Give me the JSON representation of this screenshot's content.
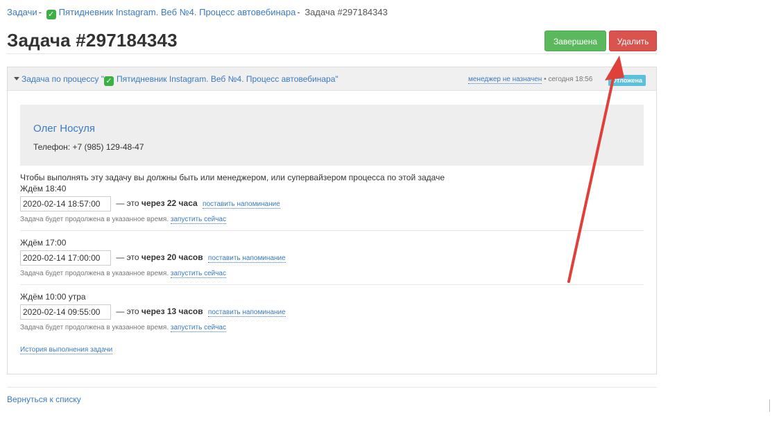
{
  "breadcrumb": {
    "items": [
      "Задачи",
      "Пятидневник Instagram. Веб №4. Процесс автовебинара"
    ],
    "separator": "-",
    "current": "Задача #297184343"
  },
  "page": {
    "title": "Задача #297184343",
    "done_button": "Завершена",
    "delete_button": "Удалить"
  },
  "panel": {
    "toggle_prefix": "Задача по процессу \"",
    "process_name": "Пятидневник Instagram. Веб №4. Процесс автовебинара",
    "toggle_suffix": "\"",
    "manager": "менеджер не назначен",
    "meta_sep": " • ",
    "time": "сегодня 18:56",
    "status": "Отложена"
  },
  "contact": {
    "name": "Олег Носуля",
    "phone": "Телефон: +7 (985) 129-48-47"
  },
  "notice": "Чтобы выполнять эту задачу вы должны быть или менеджером, или супервайзером процесса по этой задаче",
  "waits": [
    {
      "label": "Ждём 18:40",
      "datetime": "2020-02-14 18:57:00",
      "dash": "— это",
      "relative": "через 22 часа",
      "remind": "поставить напоминание",
      "sub": "Задача будет продолжена в указанное время.",
      "run_now": "запустить сейчас"
    },
    {
      "label": "Ждём 17:00",
      "datetime": "2020-02-14 17:00:00",
      "dash": "— это",
      "relative": "через 20 часов",
      "remind": "поставить напоминание",
      "sub": "Задача будет продолжена в указанное время.",
      "run_now": "запустить сейчас"
    },
    {
      "label": "Ждём 10:00 утра",
      "datetime": "2020-02-14 09:55:00",
      "dash": "— это",
      "relative": "через 13 часов",
      "remind": "поставить напоминание",
      "sub": "Задача будет продолжена в указанное время.",
      "run_now": "запустить сейчас"
    }
  ],
  "history_link": "История выполнения задачи",
  "back_link": "Вернуться к списку",
  "icons": {
    "process": "check-mark-emoji-icon",
    "toggle": "caret-down-icon",
    "annotation": "red-arrow-icon"
  },
  "colors": {
    "link": "#3a7bbf",
    "done": "#5cb85c",
    "delete": "#d9534f",
    "badge": "#5bc0de",
    "arrow": "#e0403a"
  }
}
